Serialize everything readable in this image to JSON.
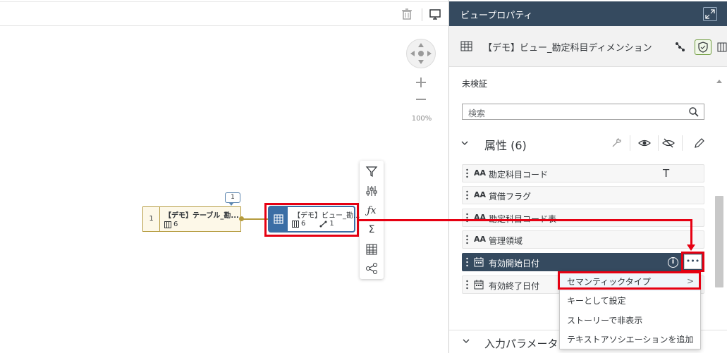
{
  "canvas": {
    "zoom_label": "100%",
    "node_table": {
      "num": "1",
      "title": "【デモ】テーブル_勘...",
      "count": "6",
      "badge": "1"
    },
    "node_view": {
      "title": "【デモ】ビュー_勘...",
      "count": "6",
      "links": "1"
    }
  },
  "panel": {
    "header_title": "ビュープロパティ",
    "view_name": "【デモ】ビュー_勘定科目ディメンション",
    "status": "未検証",
    "search_placeholder": "検索",
    "attributes_title": "属性 (6)",
    "attributes": [
      {
        "label": "勘定科目コード",
        "icon": "text-aa-icon"
      },
      {
        "label": "貸借フラグ",
        "icon": "text-aa-icon"
      },
      {
        "label": "勘定科目コード表",
        "icon": "text-aa-icon"
      },
      {
        "label": "管理領域",
        "icon": "text-aa-icon"
      },
      {
        "label": "有効開始日付",
        "icon": "calendar-icon"
      },
      {
        "label": "有効終了日付",
        "icon": "calendar-icon"
      }
    ],
    "text_indicator": "T",
    "more_label": "•••",
    "input_params_title": "入力パラメータ"
  },
  "context_menu": {
    "items": [
      "セマンティックタイプ",
      "キーとして設定",
      "ストーリーで非表示",
      "テキストアソシエーションを追加"
    ],
    "submenu_chevron": ">"
  },
  "colors": {
    "accent": "#354a5f",
    "annotation": "#e60012",
    "node_table": "#b59b3e",
    "node_view": "#3b6ea5"
  }
}
